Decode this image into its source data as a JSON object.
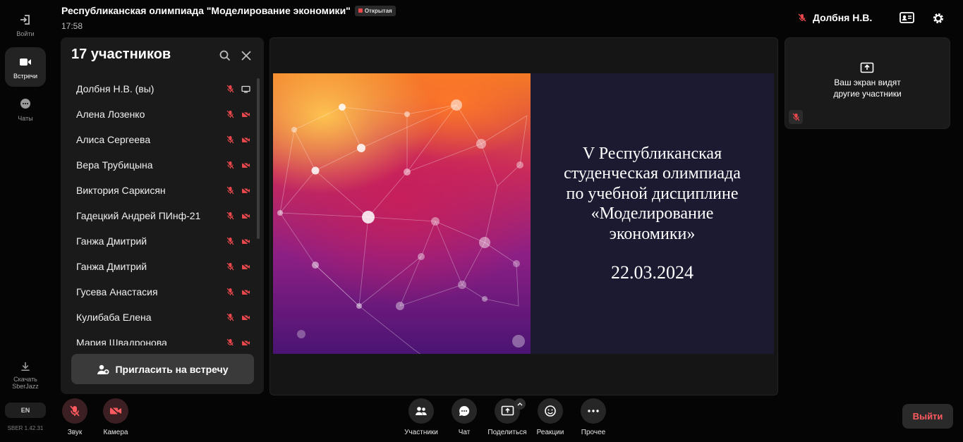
{
  "rail": {
    "login_label": "Войти",
    "meetings_label": "Встречи",
    "chats_label": "Чаты",
    "download_label_1": "Скачать",
    "download_label_2": "SberJazz",
    "lang": "EN",
    "version": "SBER 1.42.31"
  },
  "header": {
    "title": "Республиканская олимпиада \"Моделирование экономики\"",
    "badge": "Открытая",
    "time": "17:58",
    "user_name": "Долбня Н.В."
  },
  "participants": {
    "title": "17 участников",
    "items": [
      {
        "name": "Долбня Н.В. (вы)"
      },
      {
        "name": "Алена Лозенко"
      },
      {
        "name": "Алиса Сергеева"
      },
      {
        "name": "Вера Трубицына"
      },
      {
        "name": "Виктория Саркисян"
      },
      {
        "name": "Гадецкий Андрей ПИнф-21"
      },
      {
        "name": "Ганжа Дмитрий"
      },
      {
        "name": "Ганжа Дмитрий"
      },
      {
        "name": "Гусева Анастасия"
      },
      {
        "name": "Кулибаба Елена"
      },
      {
        "name": "Мария Швадронова"
      }
    ],
    "invite_label": "Пригласить на встречу"
  },
  "slide": {
    "text": "V Республиканская студенческая олимпиада по учебной дисциплине «Моделирование экономики»",
    "date": "22.03.2024"
  },
  "selfview": {
    "line1": "Ваш экран видят",
    "line2": "другие участники"
  },
  "controls": {
    "sound": "Звук",
    "camera": "Камера",
    "participants": "Участники",
    "chat": "Чат",
    "share": "Поделиться",
    "reactions": "Реакции",
    "more": "Прочее",
    "leave": "Выйти"
  },
  "colors": {
    "accent_red": "#ff5a5f",
    "muted_icon": "#e8474b",
    "slide_bg": "#1b1a31"
  }
}
